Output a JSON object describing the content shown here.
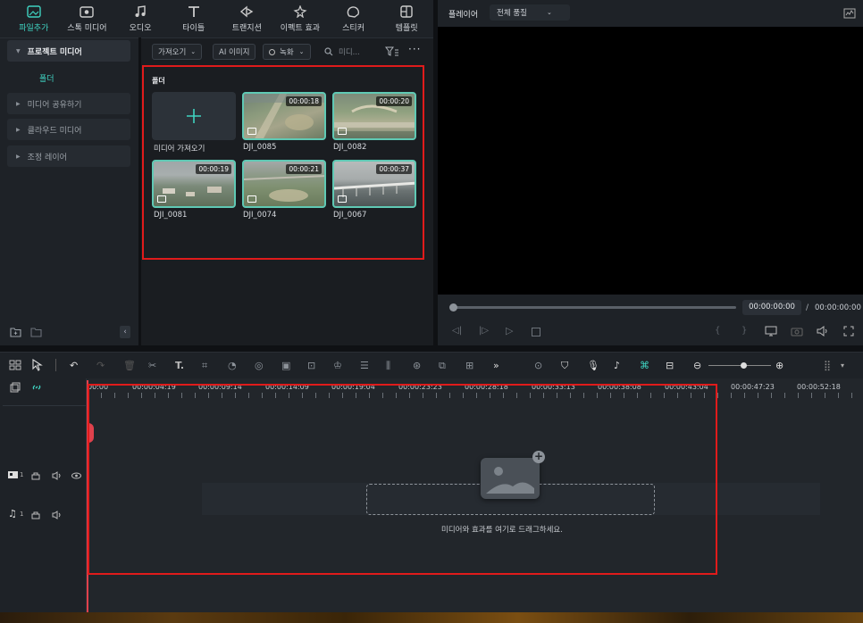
{
  "top_tabs": [
    {
      "label": "파일추가",
      "icon": "media-icon",
      "active": true
    },
    {
      "label": "스톡 미디어",
      "icon": "stock-media-icon"
    },
    {
      "label": "오디오",
      "icon": "music-note-icon"
    },
    {
      "label": "타이틀",
      "icon": "title-t-icon"
    },
    {
      "label": "트랜지션",
      "icon": "transition-icon"
    },
    {
      "label": "이펙트 효과",
      "icon": "effects-icon"
    },
    {
      "label": "스티커",
      "icon": "sticker-icon"
    },
    {
      "label": "템플릿",
      "icon": "template-icon"
    }
  ],
  "left_nav": {
    "project_media": "프로젝트 미디어",
    "folder": "폴더",
    "share_media": "미디어 공유하기",
    "cloud_media": "클라우드 미디어",
    "adjustment_layer": "조정 레이어"
  },
  "media_toolbar": {
    "import": "가져오기",
    "ai_image": "AI 이미지",
    "record": "녹화",
    "search_placeholder": "미디..."
  },
  "media_grid": {
    "folder_title": "폴더",
    "import_label": "미디어 가져오기",
    "clips": [
      {
        "name": "DJI_0085",
        "duration": "00:00:18"
      },
      {
        "name": "DJI_0082",
        "duration": "00:00:20"
      },
      {
        "name": "DJI_0081",
        "duration": "00:00:19"
      },
      {
        "name": "DJI_0074",
        "duration": "00:00:21"
      },
      {
        "name": "DJI_0067",
        "duration": "00:00:37"
      }
    ]
  },
  "player": {
    "label": "플레이어",
    "quality": "전체 품질",
    "current_time": "00:00:00:00",
    "separator": "/",
    "total_time": "00:00:00:00"
  },
  "timeline": {
    "ruler": [
      "00:00",
      "00:00:04:19",
      "00:00:09:14",
      "00:00:14:09",
      "00:00:19:04",
      "00:00:23:23",
      "00:00:28:18",
      "00:00:33:13",
      "00:00:38:08",
      "00:00:43:04",
      "00:00:47:23",
      "00:00:52:18"
    ],
    "drop_hint": "미디어와 효과를 여기로 드래그하세요.",
    "video_track_num": "1",
    "audio_track_num": "1"
  },
  "colors": {
    "accent": "#3fd2c0",
    "highlight": "#e01b1b",
    "playhead": "#e0414c"
  }
}
